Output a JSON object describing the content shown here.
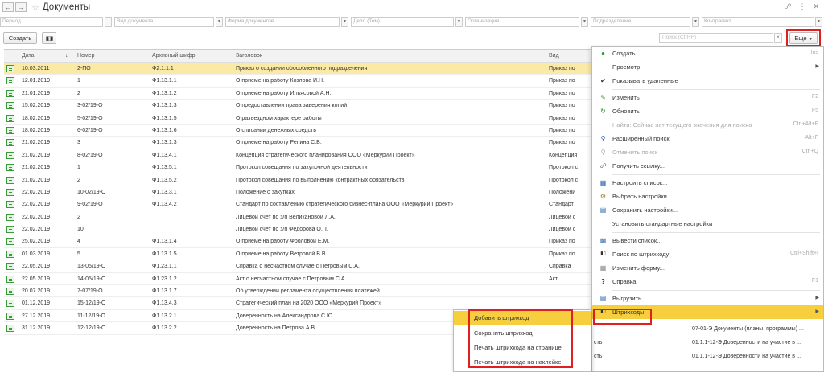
{
  "window": {
    "title": "Документы"
  },
  "filters": [
    {
      "placeholder": "Период"
    },
    {
      "placeholder": "Вид документа"
    },
    {
      "placeholder": "Форма документов"
    },
    {
      "placeholder": "Дело (Том)"
    },
    {
      "placeholder": "Организация"
    },
    {
      "placeholder": "Подразделение"
    },
    {
      "placeholder": "Контрагент"
    }
  ],
  "toolbar": {
    "create_label": "Создать",
    "search_placeholder": "Поиск (Ctrl+F)",
    "more_label": "Еще"
  },
  "table": {
    "headers": {
      "date": "Дата",
      "number": "Номер",
      "archive": "Архивный шифр",
      "title": "Заголовок",
      "kind": "Вид"
    },
    "rows": [
      {
        "date": "10.03.2011",
        "number": "2-ПО",
        "archive": "Ф2.1.1.1",
        "title": "Приказ о создании обособленного подразделения",
        "kind": "Приказ по"
      },
      {
        "date": "12.01.2019",
        "number": "1",
        "archive": "Ф1.13.1.1",
        "title": "О приеме на работу Козлова И.Н.",
        "kind": "Приказ по"
      },
      {
        "date": "21.01.2019",
        "number": "2",
        "archive": "Ф1.13.1.2",
        "title": "О приеме на работу Ильясовой А.Н.",
        "kind": "Приказ по"
      },
      {
        "date": "15.02.2019",
        "number": "3-02/19-О",
        "archive": "Ф1.13.1.3",
        "title": "О предоставлении права заверения копий",
        "kind": "Приказ по"
      },
      {
        "date": "18.02.2019",
        "number": "5-02/19-О",
        "archive": "Ф1.13.1.5",
        "title": "О разъездном характере работы",
        "kind": "Приказ по"
      },
      {
        "date": "18.02.2019",
        "number": "6-02/19-О",
        "archive": "Ф1.13.1.6",
        "title": "О списании денежных средств",
        "kind": "Приказ по"
      },
      {
        "date": "21.02.2019",
        "number": "3",
        "archive": "Ф1.13.1.3",
        "title": "О приеме на работу Репина С.В.",
        "kind": "Приказ по"
      },
      {
        "date": "21.02.2019",
        "number": "8-02/19-О",
        "archive": "Ф1.13.4.1",
        "title": "Концепция стратегического планирования ООО «Меркурий Проект»",
        "kind": "Концепция"
      },
      {
        "date": "21.02.2019",
        "number": "1",
        "archive": "Ф1.13.5.1",
        "title": "Протокол совещания по закупочной деятельности",
        "kind": "Протокол с"
      },
      {
        "date": "21.02.2019",
        "number": "2",
        "archive": "Ф1.13.5.2",
        "title": "Протокол совещания по выполнению контрактных обязательств",
        "kind": "Протокол с"
      },
      {
        "date": "22.02.2019",
        "number": "10-02/19-О",
        "archive": "Ф1.13.3.1",
        "title": "Положение о закупках",
        "kind": "Положени"
      },
      {
        "date": "22.02.2019",
        "number": "9-02/19-О",
        "archive": "Ф1.13.4.2",
        "title": "Стандарт по составлению стратегического бизнес-плана ООО «Меркурий Проект»",
        "kind": "Стандарт"
      },
      {
        "date": "22.02.2019",
        "number": "2",
        "archive": "",
        "title": "Лицевой счет по з/п Великановой Л.А.",
        "kind": "Лицевой с"
      },
      {
        "date": "22.02.2019",
        "number": "10",
        "archive": "",
        "title": "Лицевой счет по з/п Федорова О.П.",
        "kind": "Лицевой с"
      },
      {
        "date": "25.02.2019",
        "number": "4",
        "archive": "Ф1.13.1.4",
        "title": "О приеме на работу Фроловой Е.М.",
        "kind": "Приказ по"
      },
      {
        "date": "01.03.2019",
        "number": "5",
        "archive": "Ф1.13.1.5",
        "title": "О приеме на работу Ветровой В.В.",
        "kind": "Приказ по"
      },
      {
        "date": "22.05.2019",
        "number": "13-05/19-О",
        "archive": "Ф1.23.1.1",
        "title": "Справка о несчастном случае с Петровым С.А.",
        "kind": "Справка"
      },
      {
        "date": "22.05.2019",
        "number": "14-05/19-О",
        "archive": "Ф1.23.1.2",
        "title": "Акт о несчастном случае с Петровым С.А.",
        "kind": "Акт"
      },
      {
        "date": "20.07.2019",
        "number": "7-07/19-О",
        "archive": "Ф1.13.1.7",
        "title": "Об утверждении регламента осуществления платежей",
        "kind": ""
      },
      {
        "date": "01.12.2019",
        "number": "15-12/19-О",
        "archive": "Ф1.13.4.3",
        "title": "Стратегический план на 2020 ООО «Меркурий Проект»",
        "kind": ""
      },
      {
        "date": "27.12.2019",
        "number": "11-12/19-О",
        "archive": "Ф1.13.2.1",
        "title": "Доверенность на Александрова С.Ю.",
        "kind": ""
      },
      {
        "date": "31.12.2019",
        "number": "12-12/19-О",
        "archive": "Ф1.13.2.2",
        "title": "Доверенность на Петрова А.В.",
        "kind": ""
      }
    ]
  },
  "menu": {
    "create": "Создать",
    "create_sc": "Ins",
    "view": "Просмотр",
    "show_deleted": "Показывать удаленные",
    "edit": "Изменить",
    "edit_sc": "F2",
    "refresh": "Обновить",
    "refresh_sc": "F5",
    "find": "Найти: Сейчас нет текущего значения для поиска",
    "find_sc": "Ctrl+Alt+F",
    "adv_search": "Расширенный поиск",
    "adv_search_sc": "Alt+F",
    "cancel_search": "Отменить поиск",
    "cancel_search_sc": "Ctrl+Q",
    "get_link": "Получить ссылку...",
    "setup_list": "Настроить список...",
    "choose_settings": "Выбрать настройки...",
    "save_settings": "Сохранить настройки...",
    "std_settings": "Установить стандартные настройки",
    "output_list": "Вывести список...",
    "barcode_search": "Поиск по штрихкоду",
    "barcode_search_sc": "Ctrl+Shift+I",
    "change_form": "Изменить форму...",
    "help": "Справка",
    "help_sc": "F1",
    "export": "Выгрузить",
    "barcodes": "Штрихкоды"
  },
  "under_rows": [
    {
      "left": "",
      "right": "07-01-Э Документы (планы, программы) ..."
    },
    {
      "left": "сть",
      "right": "01.1.1-12-Э Доверенности на участие в ..."
    },
    {
      "left": "сть",
      "right": "01.1.1-12-Э Доверенности на участие в ..."
    }
  ],
  "submenu": {
    "add": "Добавить штрихкод",
    "save": "Сохранить штрихкод",
    "print_page": "Печать штрихкода на странице",
    "print_sticker": "Печать штрихкода на наклейке"
  }
}
